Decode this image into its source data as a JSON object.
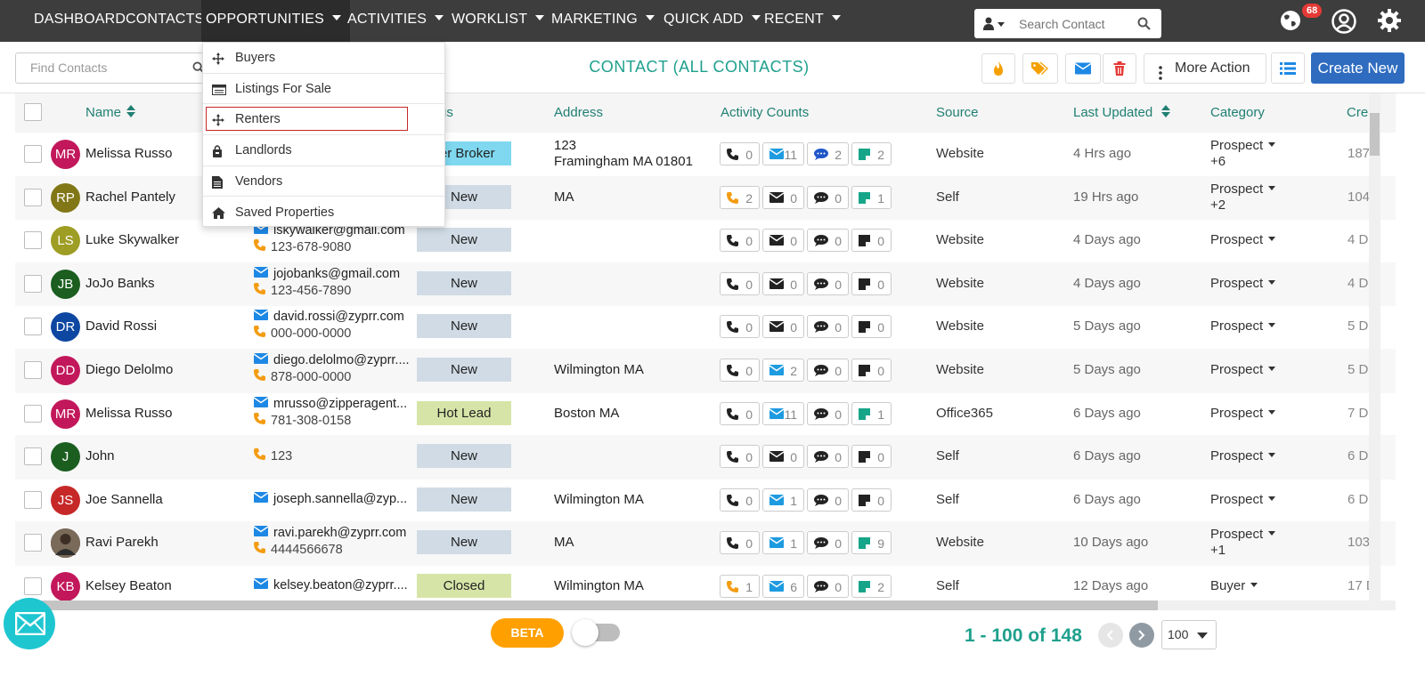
{
  "nav": {
    "items": [
      {
        "label": "DASHBOARD",
        "dropdown": false
      },
      {
        "label": "CONTACTS",
        "dropdown": false
      },
      {
        "label": "OPPORTUNITIES",
        "dropdown": true
      },
      {
        "label": "ACTIVITIES",
        "dropdown": true
      },
      {
        "label": "WORKLIST",
        "dropdown": true
      },
      {
        "label": "MARKETING",
        "dropdown": true
      },
      {
        "label": "QUICK ADD",
        "dropdown": true
      },
      {
        "label": "RECENT",
        "dropdown": true
      }
    ],
    "search_placeholder": "Search Contact",
    "notification_count": "68"
  },
  "dropdown": {
    "items": [
      {
        "label": "Buyers",
        "icon": "crosshair-icon"
      },
      {
        "label": "Listings For Sale",
        "icon": "list-card-icon"
      },
      {
        "label": "Renters",
        "icon": "crosshair-icon"
      },
      {
        "label": "Landlords",
        "icon": "bag-icon"
      },
      {
        "label": "Vendors",
        "icon": "document-icon"
      },
      {
        "label": "Saved Properties",
        "icon": "home-icon"
      }
    ]
  },
  "toolbar": {
    "find_placeholder": "Find Contacts",
    "title": "CONTACT (ALL CONTACTS)",
    "more_action": "More Action",
    "create_new": "Create New"
  },
  "table": {
    "headers": {
      "name": "Name",
      "status": "us",
      "address": "Address",
      "activity": "Activity Counts",
      "source": "Source",
      "last_updated": "Last Updated",
      "category": "Category",
      "created": "Cre"
    },
    "rows": [
      {
        "initials": "MR",
        "color": "#c2185b",
        "name": "Melissa Russo",
        "email": "",
        "phone": "",
        "status": "yer Broker",
        "status_style": "cyan",
        "address1": "123",
        "address2": "Framingham MA 01801",
        "acts": [
          [
            "call",
            "0"
          ],
          [
            "mail",
            "11"
          ],
          [
            "chat",
            "2"
          ],
          [
            "note",
            "2"
          ]
        ],
        "source": "Website",
        "updated": "4 Hrs ago",
        "category": "Prospect",
        "cat_extra": "+6",
        "created": "187"
      },
      {
        "initials": "RP",
        "color": "#827717",
        "name": "Rachel Pantely",
        "email": "",
        "phone": "",
        "status": "New",
        "status_style": "",
        "address1": "MA",
        "address2": "",
        "acts": [
          [
            "call",
            "2"
          ],
          [
            "mail",
            "0"
          ],
          [
            "chat",
            "0"
          ],
          [
            "note",
            "1"
          ]
        ],
        "source": "Self",
        "updated": "19 Hrs ago",
        "category": "Prospect",
        "cat_extra": "+2",
        "created": "104"
      },
      {
        "initials": "LS",
        "color": "#9e9d24",
        "name": "Luke Skywalker",
        "email": "lskywalker@gmail.com",
        "phone": "123-678-9080",
        "status": "New",
        "status_style": "",
        "address1": "",
        "address2": "",
        "acts": [
          [
            "call",
            "0"
          ],
          [
            "mail",
            "0"
          ],
          [
            "chat",
            "0"
          ],
          [
            "note",
            "0"
          ]
        ],
        "source": "Website",
        "updated": "4 Days ago",
        "category": "Prospect",
        "cat_extra": "",
        "created": "4 D"
      },
      {
        "initials": "JB",
        "color": "#1b5e20",
        "name": "JoJo Banks",
        "email": "jojobanks@gmail.com",
        "phone": "123-456-7890",
        "status": "New",
        "status_style": "",
        "address1": "",
        "address2": "",
        "acts": [
          [
            "call",
            "0"
          ],
          [
            "mail",
            "0"
          ],
          [
            "chat",
            "0"
          ],
          [
            "note",
            "0"
          ]
        ],
        "source": "Website",
        "updated": "4 Days ago",
        "category": "Prospect",
        "cat_extra": "",
        "created": "4 D"
      },
      {
        "initials": "DR",
        "color": "#0d47a1",
        "name": "David Rossi",
        "email": "david.rossi@zyprr.com",
        "phone": "000-000-0000",
        "status": "New",
        "status_style": "",
        "address1": "",
        "address2": "",
        "acts": [
          [
            "call",
            "0"
          ],
          [
            "mail",
            "0"
          ],
          [
            "chat",
            "0"
          ],
          [
            "note",
            "0"
          ]
        ],
        "source": "Website",
        "updated": "5 Days ago",
        "category": "Prospect",
        "cat_extra": "",
        "created": "5 D"
      },
      {
        "initials": "DD",
        "color": "#c2185b",
        "name": "Diego Delolmo",
        "email": "diego.delolmo@zyprr....",
        "phone": "878-000-0000",
        "status": "New",
        "status_style": "",
        "address1": "Wilmington MA",
        "address2": "",
        "acts": [
          [
            "call",
            "0"
          ],
          [
            "mail",
            "2"
          ],
          [
            "chat",
            "0"
          ],
          [
            "note",
            "0"
          ]
        ],
        "source": "Website",
        "updated": "5 Days ago",
        "category": "Prospect",
        "cat_extra": "",
        "created": "5 D"
      },
      {
        "initials": "MR",
        "color": "#c2185b",
        "name": "Melissa Russo",
        "email": "mrusso@zipperagent...",
        "phone": "781-308-0158",
        "status": "Hot Lead",
        "status_style": "green",
        "address1": "Boston MA",
        "address2": "",
        "acts": [
          [
            "call",
            "0"
          ],
          [
            "mail",
            "11"
          ],
          [
            "chat",
            "0"
          ],
          [
            "note",
            "1"
          ]
        ],
        "source": "Office365",
        "updated": "6 Days ago",
        "category": "Prospect",
        "cat_extra": "",
        "created": "7 D"
      },
      {
        "initials": "J",
        "color": "#1b5e20",
        "name": "John",
        "email": "",
        "phone": "123",
        "status": "New",
        "status_style": "",
        "address1": "",
        "address2": "",
        "acts": [
          [
            "call",
            "0"
          ],
          [
            "mail",
            "0"
          ],
          [
            "chat",
            "0"
          ],
          [
            "note",
            "0"
          ]
        ],
        "source": "Self",
        "updated": "6 Days ago",
        "category": "Prospect",
        "cat_extra": "",
        "created": "6 D"
      },
      {
        "initials": "JS",
        "color": "#c62828",
        "name": "Joe Sannella",
        "email": "joseph.sannella@zyp...",
        "phone": "",
        "status": "New",
        "status_style": "",
        "address1": "Wilmington MA",
        "address2": "",
        "acts": [
          [
            "call",
            "0"
          ],
          [
            "mail",
            "1"
          ],
          [
            "chat",
            "0"
          ],
          [
            "note",
            "0"
          ]
        ],
        "source": "Self",
        "updated": "6 Days ago",
        "category": "Prospect",
        "cat_extra": "",
        "created": "6 D"
      },
      {
        "initials": "",
        "color": "#5d4037",
        "name": "Ravi Parekh",
        "email": "ravi.parekh@zyprr.com",
        "phone": "4444566678",
        "status": "New",
        "status_style": "",
        "address1": "MA",
        "address2": "",
        "acts": [
          [
            "call",
            "0"
          ],
          [
            "mail",
            "1"
          ],
          [
            "chat",
            "0"
          ],
          [
            "note",
            "9"
          ]
        ],
        "source": "Website",
        "updated": "10 Days ago",
        "category": "Prospect",
        "cat_extra": "+1",
        "created": "103"
      },
      {
        "initials": "KB",
        "color": "#c2185b",
        "name": "Kelsey Beaton",
        "email": "kelsey.beaton@zyprr....",
        "phone": "",
        "status": "Closed",
        "status_style": "green",
        "address1": "Wilmington MA",
        "address2": "",
        "acts": [
          [
            "call",
            "1"
          ],
          [
            "mail",
            "6"
          ],
          [
            "chat",
            "0"
          ],
          [
            "note",
            "2"
          ]
        ],
        "source": "Self",
        "updated": "12 Days ago",
        "category": "Buyer",
        "cat_extra": "",
        "created": "17 D"
      }
    ]
  },
  "footer": {
    "beta": "BETA",
    "pager": "1 - 100 of 148",
    "per_page": "100"
  },
  "colors": {
    "accent": "#1fa08d",
    "nav_bg": "#3d3d3d",
    "primary_button": "#2f6cc0",
    "beta": "#ffa000",
    "mail_fab": "#1ec6d0"
  }
}
